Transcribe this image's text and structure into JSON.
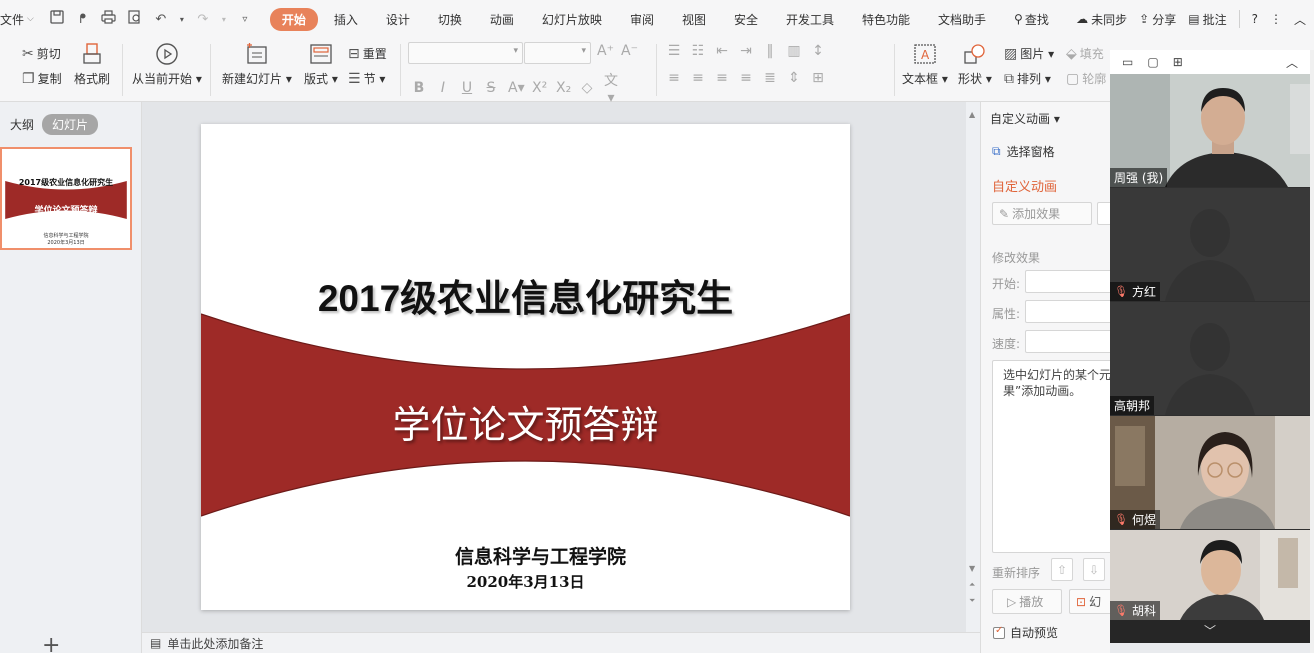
{
  "menubar": {
    "file": "文件",
    "tabs": [
      "开始",
      "插入",
      "设计",
      "切换",
      "动画",
      "幻灯片放映",
      "审阅",
      "视图",
      "安全",
      "开发工具",
      "特色功能",
      "文档助手"
    ],
    "active_tab": "开始",
    "search": "查找",
    "sync": "未同步",
    "share": "分享",
    "annotate": "批注"
  },
  "ribbon": {
    "cut": "剪切",
    "copy": "复制",
    "format_painter": "格式刷",
    "from_current": "从当前开始",
    "new_slide": "新建幻灯片",
    "layout": "版式",
    "reset": "重置",
    "section": "节",
    "textbox": "文本框",
    "shape": "形状",
    "picture": "图片",
    "arrange": "排列",
    "fill": "填充",
    "outline": "轮廓"
  },
  "left_panel": {
    "tab_outline": "大纲",
    "tab_slides": "幻灯片",
    "thumb_title": "2017级农业信息化研究生",
    "thumb_subtitle": "学位论文预答辩",
    "thumb_org": "信息科学与工程学院",
    "thumb_date": "2020年3月13日"
  },
  "slide": {
    "title_num": "2017",
    "title_text": "级农业信息化研究生",
    "subtitle": "学位论文预答辩",
    "org": "信息科学与工程学院",
    "date": "2020年3月13日",
    "band_color": "#9e2a27"
  },
  "notes": {
    "placeholder": "单击此处添加备注"
  },
  "anim_pane": {
    "title": "自定义动画",
    "select_pane": "选择窗格",
    "section_title": "自定义动画",
    "add_effect": "添加效果",
    "modify_effect": "修改效果",
    "start_label": "开始:",
    "property_label": "属性:",
    "speed_label": "速度:",
    "hint_line1": "选中幻灯片的某个元",
    "hint_line2": "果”添加动画。",
    "reorder": "重新排序",
    "play": "播放",
    "slideshow": "幻",
    "auto_preview": "自动预览"
  },
  "video_call": {
    "participants": [
      {
        "name": "周强 (我)",
        "muted": false
      },
      {
        "name": "方红",
        "muted": true
      },
      {
        "name": "高朝邦",
        "muted": false
      },
      {
        "name": "何煜",
        "muted": true
      },
      {
        "name": "胡科",
        "muted": true
      }
    ]
  },
  "colors": {
    "accent": "#e8825a",
    "slide_band": "#9e2a27"
  }
}
